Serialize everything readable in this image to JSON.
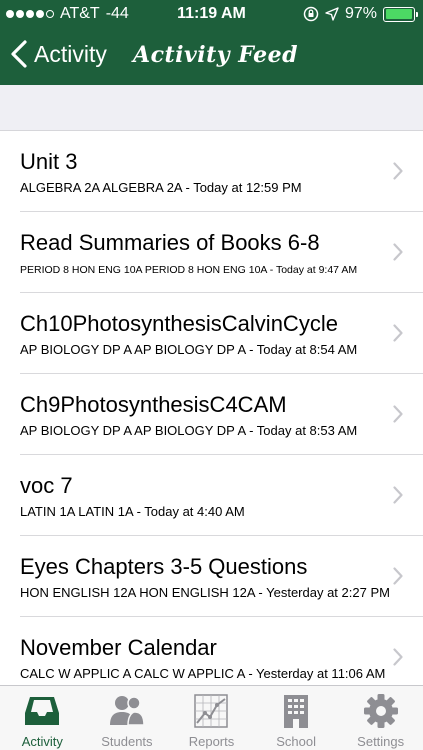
{
  "status": {
    "carrier": "AT&T",
    "signal_db": "-44",
    "time": "11:19 AM",
    "battery": "97%",
    "battery_level": 0.97
  },
  "nav": {
    "back_label": "Activity",
    "title": "Activity Feed"
  },
  "feed": [
    {
      "title": "Unit 3",
      "subtitle": "ALGEBRA 2A ALGEBRA 2A - Today at 12:59 PM"
    },
    {
      "title": "Read Summaries of Books 6-8",
      "subtitle": "PERIOD 8 HON ENG 10A PERIOD 8 HON ENG 10A - Today at 9:47 AM"
    },
    {
      "title": "Ch10PhotosynthesisCalvinCycle",
      "subtitle": "AP BIOLOGY DP A AP BIOLOGY DP A - Today at 8:54 AM"
    },
    {
      "title": "Ch9PhotosynthesisC4CAM",
      "subtitle": "AP BIOLOGY DP A AP BIOLOGY DP A - Today at 8:53 AM"
    },
    {
      "title": "voc 7",
      "subtitle": "LATIN 1A LATIN 1A - Today at 4:40 AM"
    },
    {
      "title": "Eyes Chapters 3-5 Questions",
      "subtitle": "HON ENGLISH 12A HON ENGLISH 12A - Yesterday at 2:27 PM"
    },
    {
      "title": "November Calendar",
      "subtitle": "CALC W APPLIC A CALC W APPLIC A - Yesterday at 11:06 AM"
    }
  ],
  "tabs": [
    {
      "label": "Activity",
      "icon": "inbox-icon",
      "active": true
    },
    {
      "label": "Students",
      "icon": "people-icon",
      "active": false
    },
    {
      "label": "Reports",
      "icon": "chart-icon",
      "active": false
    },
    {
      "label": "School",
      "icon": "building-icon",
      "active": false
    },
    {
      "label": "Settings",
      "icon": "gear-icon",
      "active": false
    }
  ],
  "colors": {
    "brand_green": "#1d5f3b",
    "battery_green": "#4cd964",
    "inactive_gray": "#8e8e93"
  }
}
